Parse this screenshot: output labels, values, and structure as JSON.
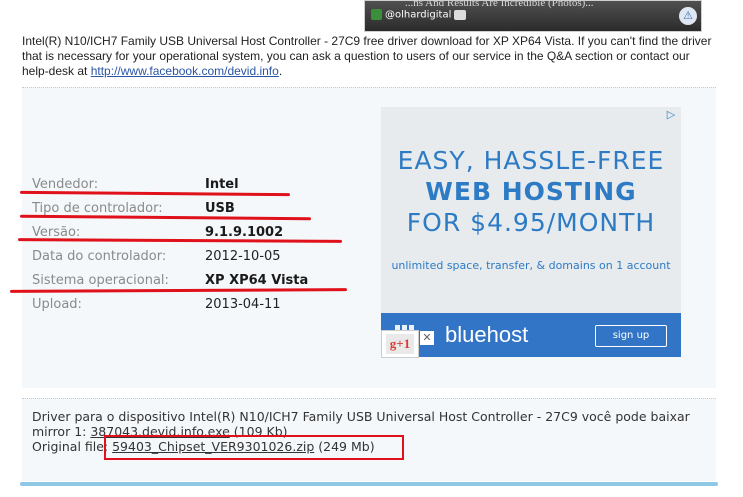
{
  "top_ad": {
    "headline": "...ns And Results Are Incredible (Photos)...",
    "brand": "@olhardigital"
  },
  "description": {
    "text_before_link": "Intel(R) N10/ICH7 Family USB Universal Host Controller - 27C9 free driver download for XP XP64 Vista. If you can't find the driver that is necessary for your operational system, you can ask a question to users of our service in the Q&A section or contact our help-desk at ",
    "link": "http://www.facebook.com/devid.info",
    "text_after_link": "."
  },
  "details": [
    {
      "label": "Vendedor:",
      "value": "Intel"
    },
    {
      "label": "Tipo de controlador:",
      "value": "USB"
    },
    {
      "label": "Versão:",
      "value": "9.1.9.1002"
    },
    {
      "label": "Data do controlador:",
      "value": "2012-10-05"
    },
    {
      "label": "Sistema operacional:",
      "value": "XP XP64 Vista"
    },
    {
      "label": "Upload:",
      "value": "2013-04-11"
    }
  ],
  "ad": {
    "line1": "EASY, HASSLE-FREE",
    "line2": "WEB HOSTING",
    "line3": "FOR $4.95/MONTH",
    "line4": "unlimited space, transfer, & domains on 1 account",
    "brand": "bluehost",
    "signup": "sign up",
    "adchoices": "▷",
    "gplus": "g+1"
  },
  "download": {
    "line1": "Driver para o dispositivo Intel(R) N10/ICH7 Family USB Universal Host Controller - 27C9 você pode baixar",
    "mirror_prefix": "mirror 1: ",
    "mirror_link": "387043.devid.info.exe",
    "mirror_size": " (109 Kb)",
    "original_prefix": "Original file: ",
    "original_link": "59403_Chipset_VER9301026.zip",
    "original_size": " (249 Mb)"
  },
  "colors": {
    "annotation_red": "#e0111a",
    "ad_blue": "#2d7bc5",
    "panel_bg": "#f4f8fb"
  }
}
